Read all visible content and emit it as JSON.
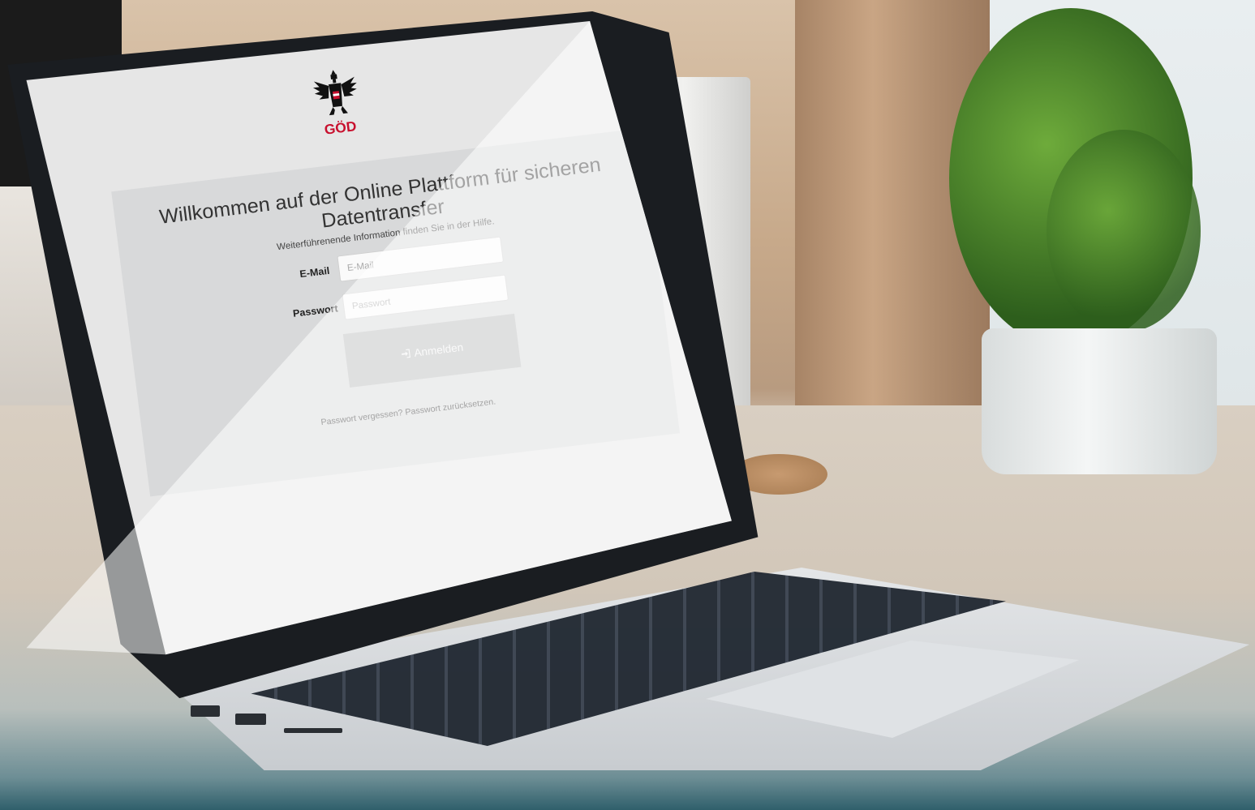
{
  "logo": {
    "text": "GÖD",
    "brand_color": "#c8102e"
  },
  "login": {
    "title": "Willkommen auf der Online Plattform für sicheren Datentransfer",
    "info": "Weiterführenende Information finden Sie in der Hilfe.",
    "email_label": "E-Mail",
    "email_placeholder": "E-Mail",
    "password_label": "Passwort",
    "password_placeholder": "Passwort",
    "submit_icon": "sign-in-icon",
    "submit_label": "Anmelden",
    "forgot_text": "Passwort vergessen? Passwort zurücksetzen."
  },
  "colors": {
    "page_background": "#e6e6e6",
    "panel_background": "#d8d9da",
    "button_background": "#b9babb"
  }
}
